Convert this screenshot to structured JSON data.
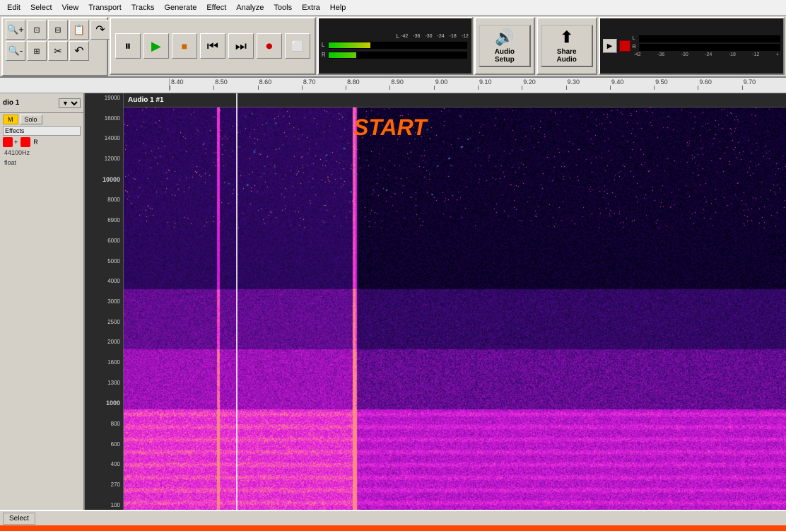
{
  "menu": {
    "items": [
      "Edit",
      "Select",
      "View",
      "Transport",
      "Tracks",
      "Generate",
      "Effect",
      "Analyze",
      "Tools",
      "Extra",
      "Help"
    ]
  },
  "toolbar": {
    "zoom_buttons": [
      "zoom-in",
      "zoom-out",
      "zoom-fit-selection",
      "zoom-fit-project",
      "zoom-toggle"
    ],
    "edit_buttons": [
      "cut",
      "paste"
    ],
    "undo_redo": [
      "undo",
      "redo"
    ],
    "transport": {
      "pause_label": "⏸",
      "play_label": "▶",
      "stop_label": "■",
      "skip_start_label": "⏮",
      "skip_end_label": "⏭",
      "record_label": "⏺",
      "loop_label": "↻"
    },
    "audio_setup_label": "Audio Setup",
    "share_audio_label": "Share Audio"
  },
  "level_meter": {
    "ticks": [
      "-42",
      "-36",
      "-30",
      "-24",
      "-18",
      "-12"
    ],
    "ticks_playback": [
      "-42",
      "-36",
      "-30",
      "-24",
      "-18",
      "-12"
    ]
  },
  "timeline": {
    "ticks": [
      {
        "label": "8.40",
        "pos": 0
      },
      {
        "label": "8.50",
        "pos": 1
      },
      {
        "label": "8.60",
        "pos": 2
      },
      {
        "label": "8.70",
        "pos": 3
      },
      {
        "label": "8.80",
        "pos": 4
      },
      {
        "label": "8.90",
        "pos": 5
      },
      {
        "label": "9.00",
        "pos": 6
      },
      {
        "label": "9.10",
        "pos": 7
      },
      {
        "label": "9.20",
        "pos": 8
      },
      {
        "label": "9.30",
        "pos": 9
      },
      {
        "label": "9.40",
        "pos": 10
      },
      {
        "label": "9.50",
        "pos": 11
      },
      {
        "label": "9.60",
        "pos": 12
      },
      {
        "label": "9.70",
        "pos": 13
      }
    ]
  },
  "track": {
    "name": "dio 1",
    "title": "Audio 1 #1",
    "sample_rate": "44100Hz",
    "bit_depth": "float",
    "solo_label": "Solo",
    "effects_label": "Effects"
  },
  "spectrogram": {
    "start_label": "START",
    "freq_labels": [
      "19000",
      "16000",
      "14000",
      "12000",
      "10000",
      "8000",
      "6900",
      "6000",
      "5000",
      "4000",
      "3000",
      "2500",
      "2000",
      "1600",
      "1300",
      "1000",
      "800",
      "600",
      "400",
      "270",
      "100"
    ]
  },
  "status_bar": {
    "select_label": "Select"
  }
}
